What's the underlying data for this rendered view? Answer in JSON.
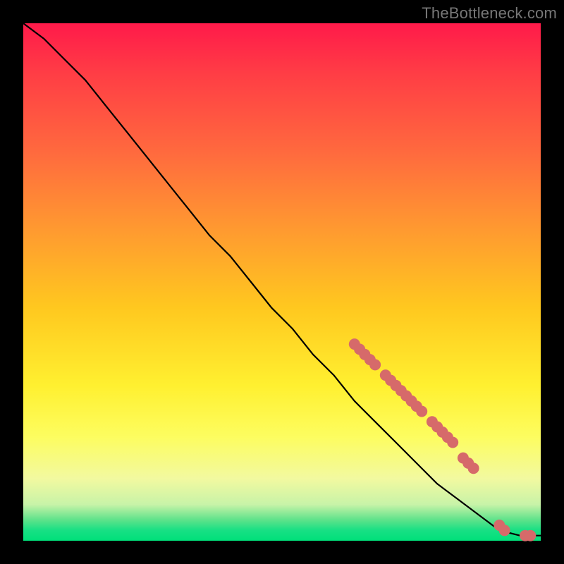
{
  "watermark": "TheBottleneck.com",
  "chart_data": {
    "type": "line",
    "title": "",
    "xlabel": "",
    "ylabel": "",
    "xlim": [
      0,
      100
    ],
    "ylim": [
      0,
      100
    ],
    "grid": false,
    "series": [
      {
        "name": "bottleneck-curve",
        "color": "#000000",
        "x": [
          0,
          4,
          8,
          12,
          16,
          20,
          24,
          28,
          32,
          36,
          40,
          44,
          48,
          52,
          56,
          60,
          64,
          68,
          72,
          76,
          80,
          84,
          88,
          92,
          96,
          100
        ],
        "y": [
          100,
          97,
          93,
          89,
          84,
          79,
          74,
          69,
          64,
          59,
          55,
          50,
          45,
          41,
          36,
          32,
          27,
          23,
          19,
          15,
          11,
          8,
          5,
          2,
          1,
          1
        ]
      }
    ],
    "markers": {
      "name": "highlighted-points",
      "color": "#d66a6a",
      "radius": 8,
      "x": [
        64,
        65,
        66,
        67,
        68,
        70,
        71,
        72,
        73,
        74,
        75,
        76,
        77,
        79,
        80,
        81,
        82,
        83,
        85,
        86,
        87,
        92,
        93,
        97,
        98
      ],
      "y": [
        38,
        37,
        36,
        35,
        34,
        32,
        31,
        30,
        29,
        28,
        27,
        26,
        25,
        23,
        22,
        21,
        20,
        19,
        16,
        15,
        14,
        3,
        2,
        1,
        1
      ]
    },
    "gradient_stops": [
      {
        "pos": 0.0,
        "color": "#ff1a4a"
      },
      {
        "pos": 0.4,
        "color": "#ff9a30"
      },
      {
        "pos": 0.7,
        "color": "#fff030"
      },
      {
        "pos": 0.93,
        "color": "#c8f3a8"
      },
      {
        "pos": 1.0,
        "color": "#00e07a"
      }
    ]
  }
}
